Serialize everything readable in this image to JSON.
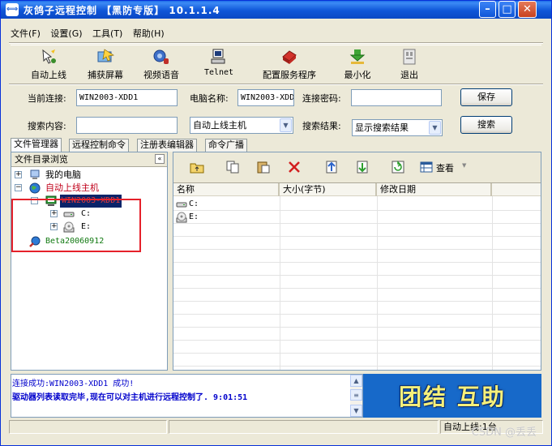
{
  "window": {
    "title": "灰鸽子远程控制  【黑防专版】   10.1.1.4",
    "app_icon": "arrows-icon"
  },
  "menu": [
    "文件(F)",
    "设置(G)",
    "工具(T)",
    "帮助(H)"
  ],
  "toolbar": [
    {
      "label": "自动上线",
      "icon": "auto-online-icon"
    },
    {
      "label": "捕获屏幕",
      "icon": "capture-screen-icon"
    },
    {
      "label": "视频语音",
      "icon": "video-voice-icon"
    },
    {
      "label": "Telnet",
      "icon": "telnet-icon"
    },
    {
      "label": "配置服务程序",
      "icon": "config-service-icon"
    },
    {
      "label": "最小化",
      "icon": "minimize-icon"
    },
    {
      "label": "退出",
      "icon": "exit-icon"
    }
  ],
  "connection": {
    "current_label": "当前连接:",
    "current_value": "WIN2003-XDD1",
    "computer_label": "电脑名称:",
    "computer_value": "WIN2003-XDD",
    "password_label": "连接密码:",
    "password_value": "",
    "save_button": "保存"
  },
  "search": {
    "content_label": "搜索内容:",
    "content_value": "",
    "scope_value": "自动上线主机",
    "result_label": "搜索结果:",
    "result_value": "显示搜索结果",
    "search_button": "搜索"
  },
  "tabs": [
    "文件管理器",
    "远程控制命令",
    "注册表编辑器",
    "命令广播"
  ],
  "tree": {
    "header": "文件目录浏览",
    "collapse": "«",
    "items": {
      "my_computer": "我的电脑",
      "auto_hosts": "自动上线主机",
      "host": "WIN2003-XDD1",
      "drive_c": "C:",
      "drive_e": "E:",
      "beta": "Beta20060912"
    }
  },
  "file_list": {
    "view_label": "查看",
    "columns": [
      "名称",
      "大小(字节)",
      "修改日期"
    ],
    "rows": [
      {
        "name": "C:",
        "icon": "drive-icon"
      },
      {
        "name": "E:",
        "icon": "cdrom-icon"
      }
    ]
  },
  "log": {
    "line1": "连接成功:WIN2003-XDD1 成功!",
    "line2": "驱动器列表读取完毕,现在可以对主机进行远程控制了.  9:01:51"
  },
  "banner": "团结 互助",
  "status": {
    "auto_online": "自动上线:1台"
  },
  "watermark": "CSDN @丢丢",
  "colors": {
    "titlebar": "#0F56D8",
    "highlight_box": "#E5212A",
    "log_text": "#0000CC",
    "banner_bg": "#1769C9",
    "banner_text": "#F6F07A"
  }
}
